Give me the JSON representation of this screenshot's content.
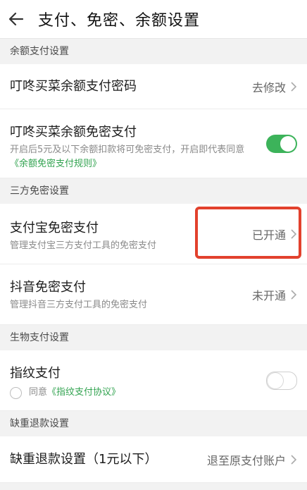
{
  "header": {
    "title": "支付、免密、余额设置"
  },
  "sections": {
    "balance": "余额支付设置",
    "third_party": "三方免密设置",
    "biometric": "生物支付设置",
    "refund": "缺重退款设置"
  },
  "balance_password": {
    "label": "叮咚买菜余额支付密码",
    "action": "去修改"
  },
  "balance_free": {
    "label": "叮咚买菜余额免密支付",
    "desc_prefix": "开启后5元及以下余额扣款将可免密支付，开启即代表同意",
    "desc_link": "《余额免密支付规则》",
    "enabled": true
  },
  "alipay": {
    "label": "支付宝免密支付",
    "desc": "管理支付宝三方支付工具的免密支付",
    "status": "已开通"
  },
  "douyin": {
    "label": "抖音免密支付",
    "desc": "管理抖音三方支付工具的免密支付",
    "status": "未开通"
  },
  "fingerprint": {
    "label": "指纹支付",
    "agree": "同意",
    "agreement_link": "《指纹支付协议》",
    "enabled": false
  },
  "refund": {
    "label": "缺重退款设置（1元以下）",
    "value": "退至原支付账户"
  },
  "colors": {
    "accent": "#3cb35a",
    "highlight": "#e2412d"
  }
}
